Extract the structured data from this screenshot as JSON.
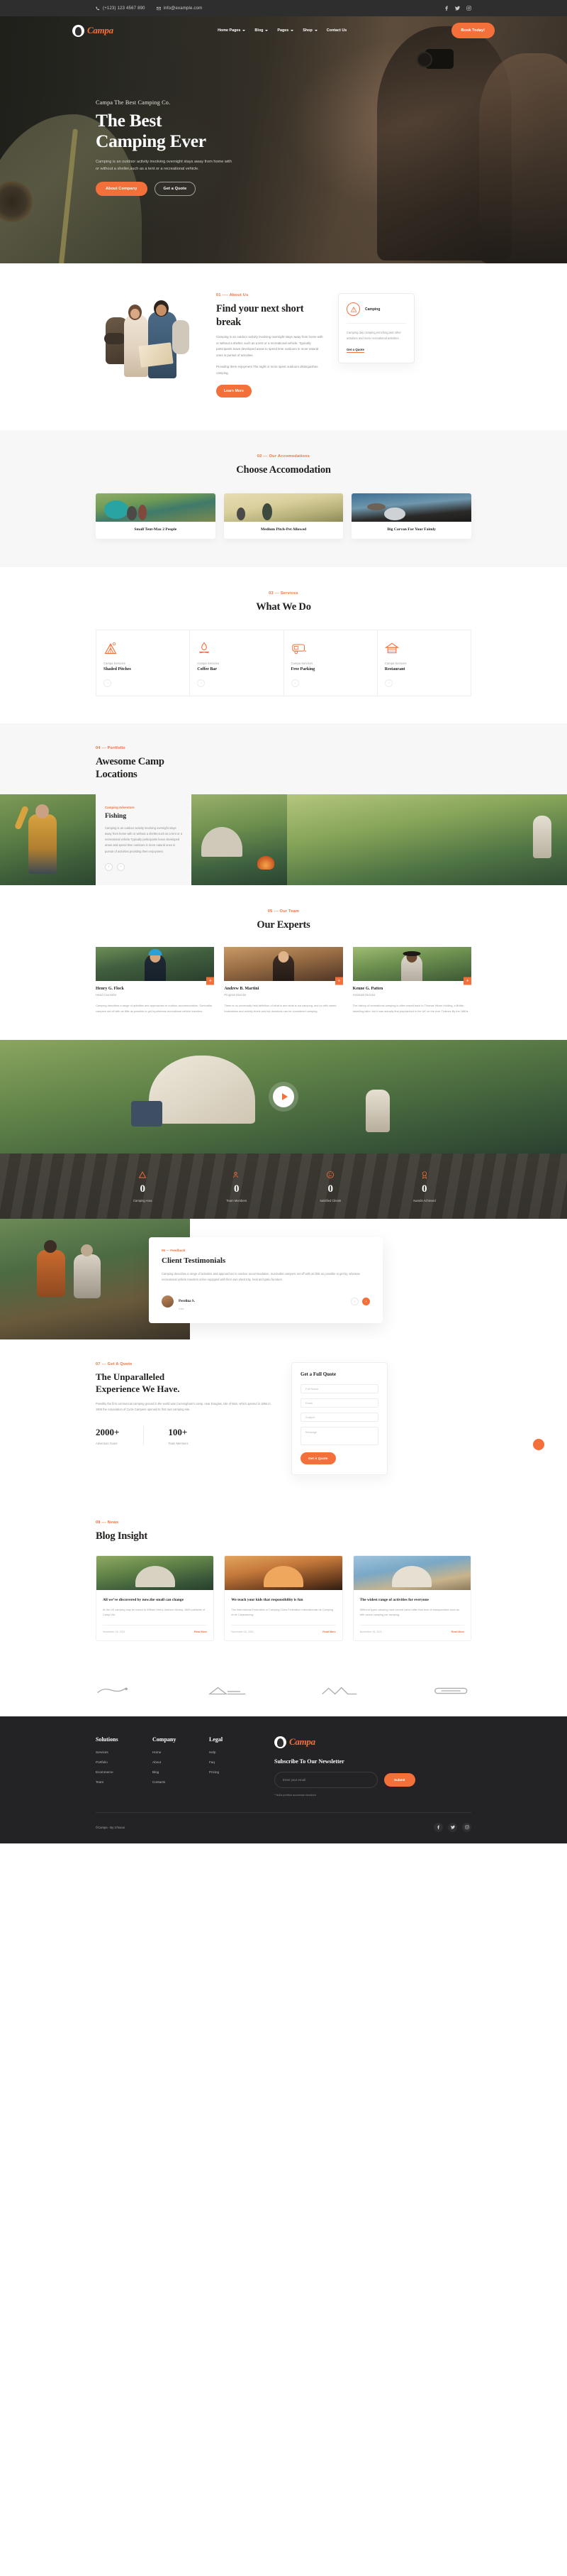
{
  "topbar": {
    "phone": "(+123) 123 4567 890",
    "email": "info@example.com",
    "socials": [
      "facebook-icon",
      "twitter-icon",
      "instagram-icon"
    ]
  },
  "brand": {
    "name": "Campa"
  },
  "nav": {
    "items": [
      {
        "label": "Home Pages",
        "has_dropdown": true
      },
      {
        "label": "Blog",
        "has_dropdown": true
      },
      {
        "label": "Pages",
        "has_dropdown": true
      },
      {
        "label": "Shop",
        "has_dropdown": true
      },
      {
        "label": "Contact Us",
        "has_dropdown": false
      }
    ],
    "cta": "Book Today!"
  },
  "hero": {
    "kicker": "Campa The Best Camping Co.",
    "title_line1": "The Best",
    "title_line2": "Camping Ever",
    "subtitle": "Camping is an outdoor activity involving overnight stays away from home with or without a shelter,such as a tent or a recreational vehicle.",
    "btn_primary": "About Company",
    "btn_secondary": "Get a Quote"
  },
  "about": {
    "kicker": "01 ---- About Us",
    "title": "Find your next short break",
    "paragraph": "Camping is an outdoor activity involving overnight stays away from home with or without a shelter, such as a tent or a recreational vehicle. Typically participants leave developed areas to spend time outdoors in more natural ones in pursuit of activities.",
    "paragraph2": "Providing them enjoyment.The night or more spent outdoors distinguishes camping.",
    "button": "Learn More",
    "card": {
      "icon": "tent-icon",
      "title": "Camping",
      "body": "Camping day camping,enriching,and other activities and more recreational activities.",
      "link": "Get a Quote"
    }
  },
  "accommodation": {
    "kicker": "02 --- Our Accomodations",
    "title": "Choose Accomodation",
    "cards": [
      {
        "caption": "Small Tent-Max 2 People"
      },
      {
        "caption": "Medium Pitch-Pet Allowed"
      },
      {
        "caption": "Big Carvan For Your Faimly"
      }
    ]
  },
  "services": {
    "kicker": "03 --- Services",
    "title": "What We Do",
    "items": [
      {
        "sub": "Campa Services",
        "name": "Shaded Pitches",
        "icon": "tent-icon",
        "arrow": "→"
      },
      {
        "sub": "Campa Services",
        "name": "Coffee Bar",
        "icon": "campfire-icon",
        "arrow": "→"
      },
      {
        "sub": "Campa Services",
        "name": "Free Parking",
        "icon": "caravan-icon",
        "arrow": "→"
      },
      {
        "sub": "Campa Services",
        "name": "Restaurant",
        "icon": "cabin-icon",
        "arrow": "→"
      }
    ]
  },
  "portfolio": {
    "kicker": "04 --- Portfolio",
    "title_line1": "Awesome Camp",
    "title_line2": "Locations",
    "item_kicker": "Camping Adventure",
    "item_title": "Fishing",
    "item_body": "Camping is an outdoor activity involving overnight stays away from home with or without a shelter,such as a tent or a recreational vehicle.Typically participants leave developed areas and spend time outdoors in more natural ones in pursuit of activities providing them enjoyment.",
    "prev": "‹",
    "next": "›"
  },
  "experts": {
    "kicker": "05 --- Our Team",
    "title": "Our Experts",
    "members": [
      {
        "name": "Henry G. Flock",
        "role": "Head Counselor",
        "bio": "Camping describes a range of activities and approaches to outdoor accommodation. Survivalist campers set off with as little as possible to get by,whereas recreational vehicle travelers.",
        "plus": "+"
      },
      {
        "name": "Andrew B. Martini",
        "role": "Program Director",
        "bio": "There is no universally held definition of what is and what is not camping, and so with varied motivations and activity levels and trip durations can be considered camping.",
        "plus": "+"
      },
      {
        "name": "Kenne G. Patten",
        "role": "Assistant Director",
        "bio": "The history of recreational camping is often traced back to Thomas Hiram Holding, a British travelling tailor, but it was actually first popularized in the UK on the river Thames By the 1880s.",
        "plus": "+"
      }
    ]
  },
  "video": {
    "play": "play-button-icon"
  },
  "counters": [
    {
      "icon": "tent-icon",
      "number": "0",
      "label": "Camping Area"
    },
    {
      "icon": "team-icon",
      "number": "0",
      "label": "Team Members"
    },
    {
      "icon": "smile-icon",
      "number": "0",
      "label": "Satisfied Clients"
    },
    {
      "icon": "award-icon",
      "number": "0",
      "label": "Awards Achieved"
    }
  ],
  "testimonials": {
    "kicker": "06 --- Feedback",
    "title": "Client Testimonials",
    "body": "Camping describes a range of activities and approaches to outdoor accommodation. Survivalist campers set off with as little as possible to get by, whereas recreational vehicle travelers arrive equipped with their own electricity, heat and patio furniture.",
    "author_name": "Perelina S.",
    "author_role": "Ceo",
    "prev": "‹",
    "next": "›"
  },
  "quote": {
    "kicker": "07 --- Get A Quote",
    "title_line1": "The Unparalleled",
    "title_line2": "Experience We Have.",
    "paragraph": "Possibly the first commercial camping ground in the world was Cunningham's camp, near Douglas, Isle of Man, which opened in 1894.In 1906 the Association of Cycle Campers opened its first own camping site.",
    "stats": [
      {
        "number": "2000",
        "suffix": "+",
        "label": "Adventure Goals"
      },
      {
        "number": "100",
        "suffix": "+",
        "label": "Team Members"
      }
    ],
    "form": {
      "title": "Get a Full Quote",
      "fields": [
        {
          "placeholder": "Full Name"
        },
        {
          "placeholder": "Email"
        },
        {
          "placeholder": "Subject"
        },
        {
          "placeholder": "Message"
        }
      ],
      "button": "Get A Quote"
    }
  },
  "blog": {
    "kicker": "08 --- News",
    "title": "Blog Insight",
    "posts": [
      {
        "title": "All we’ve discovered by now.the small can change",
        "excerpt": "At the UK camping may be traced to William Henry Jackson Murray, 1869 publisher of Camp Life.",
        "date": "November 16, 2021",
        "more": "Read More"
      },
      {
        "title": "We teach your kids that responsibility is fun",
        "excerpt": "The International Federation of Camping Clubs Federation Internationale de Camping et de Caravanning.",
        "date": "November 16, 2021",
        "more": "Read More"
      },
      {
        "title": "The widest range of activities for everyone",
        "excerpt": "Different types camping have served varied after that form of transportation such as with canoe camping car camping.",
        "date": "November 16, 2021",
        "more": "Read More"
      }
    ]
  },
  "brands": [
    "seazone-brand",
    "outdoor-brand",
    "mountaineer-brand",
    "campfire-brand"
  ],
  "footer": {
    "columns": [
      {
        "title": "Solutions",
        "links": [
          "Services",
          "Portfolio",
          "Ecommerce",
          "Team"
        ]
      },
      {
        "title": "Company",
        "links": [
          "Home",
          "About",
          "Blog",
          "Contacts"
        ]
      },
      {
        "title": "Legal",
        "links": [
          "Help",
          "Faq",
          "Pricing"
        ]
      }
    ],
    "newsletter_title": "Subscribe To Our Newsletter",
    "email_placeholder": "Enter your email",
    "submit": "Submit",
    "note": "* Nulla porttitor accumsan tincidunt.",
    "copyright": "©Campa - By 17sucai",
    "socials": [
      "facebook-icon",
      "twitter-icon",
      "instagram-icon"
    ]
  },
  "colors": {
    "accent": "#f4703a",
    "dark": "#232325",
    "topbar": "#2e2e2e",
    "muted": "#f7f7f7"
  }
}
